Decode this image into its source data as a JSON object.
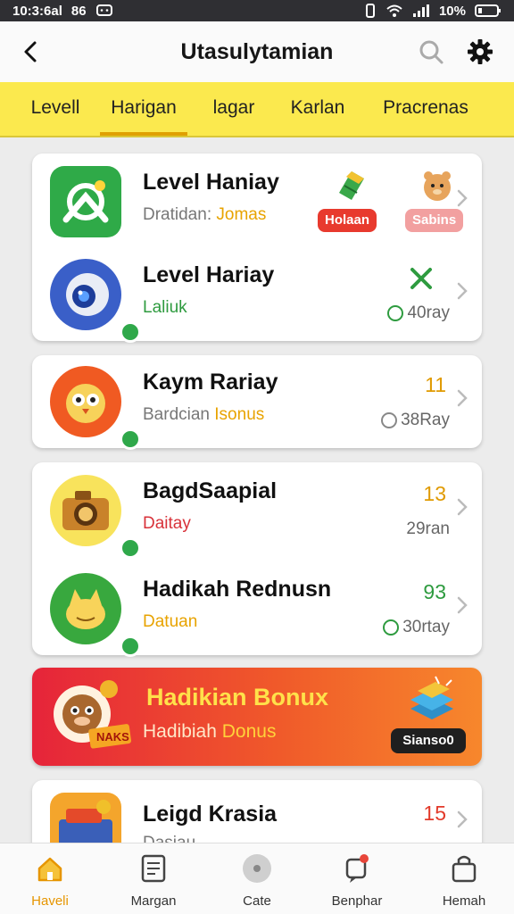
{
  "status_bar": {
    "time": "10:3:6al",
    "network": "86",
    "battery": "10%",
    "icons": [
      "message-icon",
      "vibrate-icon",
      "wifi-icon",
      "signal-icon",
      "battery-icon"
    ]
  },
  "header": {
    "title": "Utasulytamian",
    "icons": [
      "back-arrow-icon",
      "search-icon",
      "gear-icon"
    ]
  },
  "tabs": [
    {
      "label": "Levell",
      "active": false
    },
    {
      "label": "Harigan",
      "active": true
    },
    {
      "label": "lagar",
      "active": false
    },
    {
      "label": "Karlan",
      "active": false
    },
    {
      "label": "Pracrenas",
      "active": false
    }
  ],
  "cards": [
    {
      "rows": [
        {
          "title": "Level Haniay",
          "sub_prefix": "Dratidan:",
          "sub_highlight": "Jomas",
          "pills": [
            {
              "label": "Holaan",
              "color": "#e83a2e"
            },
            {
              "label": "Sabins",
              "color": "#f08a8a"
            }
          ]
        },
        {
          "title": "Level Hariay",
          "sub_prefix": "",
          "sub_highlight": "Laliuk",
          "value": "",
          "meta": "40ray"
        }
      ]
    },
    {
      "rows": [
        {
          "title": "Kaym Rariay",
          "sub_prefix": "Bardcian",
          "sub_highlight": "Isonus",
          "value": "11",
          "meta": "38Ray"
        }
      ]
    },
    {
      "rows": [
        {
          "title": "BagdSaapial",
          "sub_prefix": "",
          "sub_highlight": "Daitay",
          "value": "13",
          "meta": "29ran"
        },
        {
          "title": "Hadikah Rednusn",
          "sub_prefix": "",
          "sub_highlight": "Datuan",
          "value": "93",
          "meta": "30rtay"
        }
      ]
    }
  ],
  "promo": {
    "title": "Hadikian Bonux",
    "sub_prefix": "Hadibiah",
    "sub_highlight": "Donus",
    "button": "Sianso0",
    "tag": "NAKS"
  },
  "partial_card": {
    "title": "Leigd Krasia",
    "value": "15",
    "sub": "Dasiau"
  },
  "bottom_nav": [
    {
      "label": "Haveli",
      "icon": "home-icon",
      "active": true
    },
    {
      "label": "Margan",
      "icon": "list-icon",
      "active": false
    },
    {
      "label": "Cate",
      "icon": "circle-icon",
      "active": false
    },
    {
      "label": "Benphar",
      "icon": "bell-icon",
      "active": false
    },
    {
      "label": "Hemah",
      "icon": "bag-icon",
      "active": false
    }
  ],
  "colors": {
    "accent_yellow": "#fbe94e",
    "accent_orange": "#e69500",
    "green": "#2e9b3f",
    "red": "#e83a2e"
  }
}
